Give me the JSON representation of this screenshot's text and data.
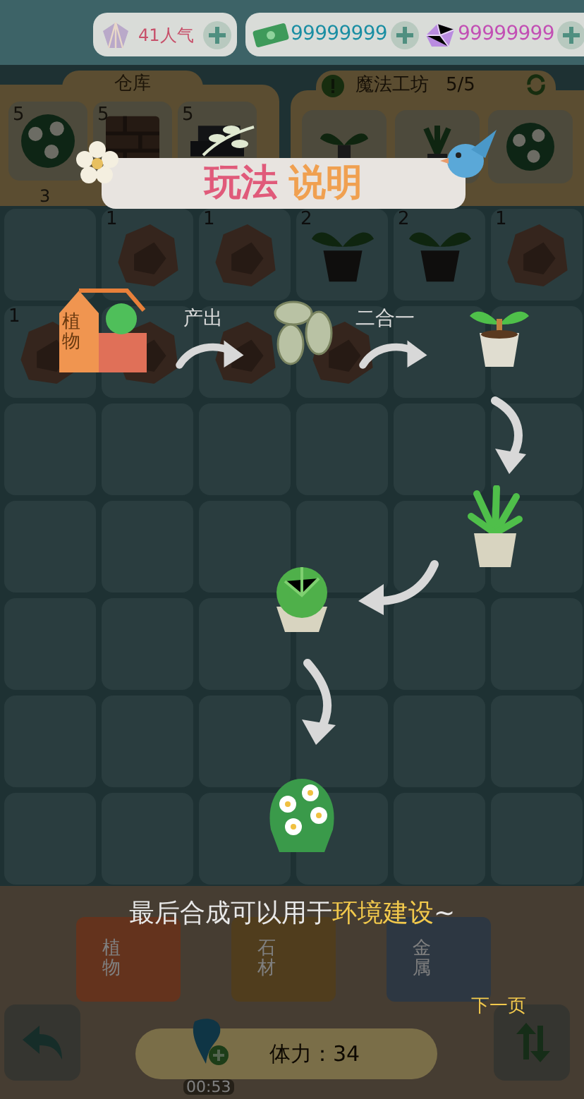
{
  "top_bar": {
    "popularity": "41人气",
    "cash": "99999999",
    "gems": "99999999"
  },
  "warehouse": {
    "title": "仓库",
    "slots": [
      {
        "kind": "bush",
        "count": "5",
        "sub": "3"
      },
      {
        "kind": "bricks",
        "count": "5"
      },
      {
        "kind": "metal",
        "count": "5"
      }
    ]
  },
  "workshop": {
    "title": "魔法工坊",
    "capacity": "5/5",
    "slots": [
      {
        "kind": "sprout"
      },
      {
        "kind": "plant"
      },
      {
        "kind": "bush"
      }
    ]
  },
  "grid": {
    "rows": [
      [
        {
          "kind": "empty"
        },
        {
          "kind": "rock",
          "count": "1"
        },
        {
          "kind": "rock",
          "count": "1"
        },
        {
          "kind": "pot",
          "count": "2"
        },
        {
          "kind": "pot",
          "count": "2"
        },
        {
          "kind": "rock",
          "count": "1"
        }
      ],
      [
        {
          "kind": "rock",
          "count": "1"
        },
        {
          "kind": "rock"
        },
        {
          "kind": "rock"
        },
        {
          "kind": "rock"
        },
        {
          "kind": "empty"
        },
        {
          "kind": "empty"
        }
      ]
    ]
  },
  "guide": {
    "title_a": "玩法",
    "title_b": "说明",
    "crate_label": "植物",
    "step_1": "产出",
    "step_2": "二合一",
    "caption": "最后合成可以用于**环境建设**~",
    "next": "下一页"
  },
  "bottom": {
    "boxes": [
      {
        "label": "植物",
        "kind": "plant"
      },
      {
        "label": "石材",
        "kind": "stone"
      },
      {
        "label": "金属",
        "kind": "metal"
      }
    ],
    "stamina": "体力：34",
    "timer": "00:53"
  }
}
